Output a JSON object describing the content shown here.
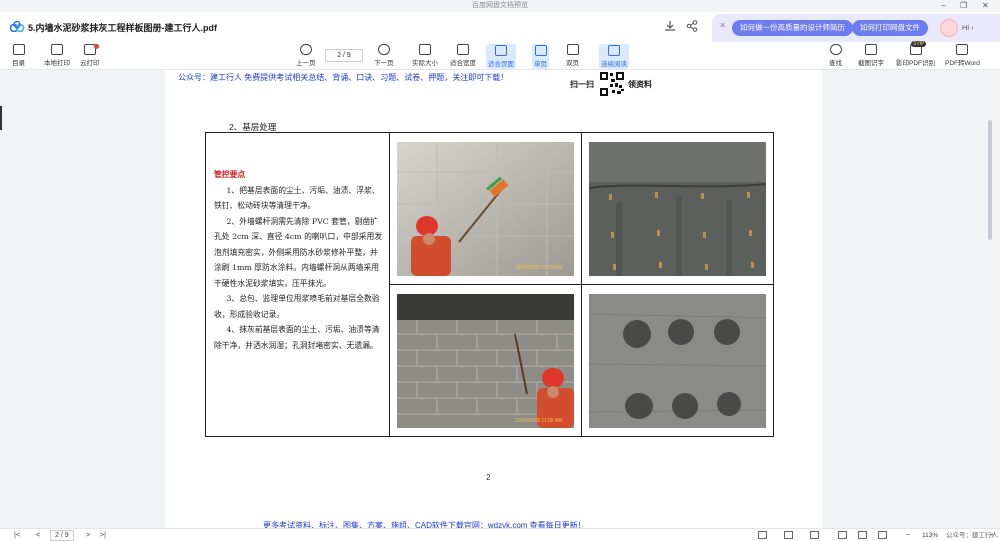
{
  "titlebar": {
    "title": "百度网盘文档预览",
    "minimize": "–",
    "restore": "❐",
    "close": "✕"
  },
  "tab": {
    "file_name": "5.内墙水泥砂浆抹灰工程样板图册-建工行人.pdf"
  },
  "promo": {
    "close": "×",
    "link1": "如何做一份高质量的设计师简历",
    "link2": "如何打印网盘文件",
    "greeting": "Hi ›"
  },
  "toolbar": {
    "left": [
      {
        "label": "目录",
        "icon": "toc-icon"
      },
      {
        "label": "本地打印",
        "icon": "print-icon"
      },
      {
        "label": "云打印",
        "icon": "cloud-print-icon"
      }
    ],
    "center": [
      {
        "label": "上一页",
        "icon": "prev-page-icon"
      },
      {
        "label": "下一页",
        "icon": "next-page-icon"
      },
      {
        "label": "实际大小",
        "icon": "actual-size-icon"
      },
      {
        "label": "适合宽度",
        "icon": "fit-width-icon"
      },
      {
        "label": "适合页面",
        "icon": "fit-page-icon"
      },
      {
        "label": "单页",
        "icon": "single-page-icon"
      },
      {
        "label": "双页",
        "icon": "double-page-icon"
      },
      {
        "label": "连续阅读",
        "icon": "continuous-icon"
      }
    ],
    "page_indicator": "2 / 9",
    "right": [
      {
        "label": "查找",
        "icon": "search-icon"
      },
      {
        "label": "截图识字",
        "icon": "ocr-icon"
      },
      {
        "label": "影印PDF识别",
        "icon": "scan-pdf-icon"
      },
      {
        "label": "PDF转Word",
        "icon": "pdf-word-icon"
      }
    ],
    "svip_badge": "SVIP"
  },
  "document": {
    "header_note": "公众号：建工行人 免费提供考试相关总结、背诵、口诀、习题、试卷、押题，关注即可下载！",
    "qr_text_left": "扫一扫",
    "qr_text_right": "领资料",
    "section_title": "2、基层处理",
    "control_heading": "管控要点",
    "paragraphs": [
      "1、把基层表面的尘土、污垢、油渍、浮浆、铁钉、松动砖块等清理干净。",
      "2、外墙螺杆洞需先清除 PVC 套管，剔凿扩孔处 2cm 深、直径 4cm 的喇叭口，中部采用发泡剂填充密实，外侧采用防水砂浆修补平整，并涂刷 1mm 厚防水涂料。内墙螺杆洞从两墙采用干硬性水泥砂浆填实，压平抹光。",
      "3、总包、监理单位甩浆喷毛前对基层全数验收，形成验收记录。",
      "4、抹灰前基层表面的尘土、污垢、油渍等清除干净，并洒水润湿；孔洞封堵密实、无遗漏。"
    ],
    "photo_timestamps": [
      "2010/06/08 11:30 AM",
      "2010/06/08 11:08 AM"
    ],
    "page_number": "2",
    "footer_link": "更多考试资料、标注、图集、方案、施组、CAD软件下载官网：wdzyk.com 查看每日更新！"
  },
  "statusbar": {
    "page": "2 / 9",
    "zoom": "113%",
    "watermark": "公众号：建工行人",
    "first": "|<",
    "prev": "<",
    "next": ">",
    "last": ">|",
    "zoom_out": "−",
    "zoom_in": "+"
  },
  "colors": {
    "accent": "#2b6ff0",
    "promo": "#6e7cf2",
    "red_heading": "#d81e1e",
    "link_blue": "#1a39d9"
  }
}
